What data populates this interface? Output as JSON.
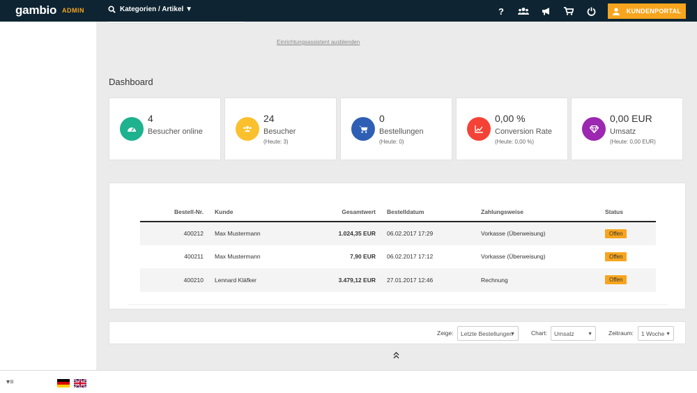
{
  "topbar": {
    "logo": "gambio",
    "admin": "ADMIN",
    "search_label": "Kategorien / Artikel ▼",
    "kundenportal": "KUNDENPORTAL",
    "icons": [
      "help-icon",
      "customers-icon",
      "megaphone-icon",
      "cart-icon",
      "power-icon"
    ]
  },
  "assist_link": "Einrichtungsassistent ausblenden",
  "dashboard_title": "Dashboard",
  "stats": [
    {
      "value": "4",
      "label": "Besucher online",
      "sub": "",
      "color": "#1fb28e",
      "icon": "gauge-icon"
    },
    {
      "value": "24",
      "label": "Besucher",
      "sub": "(Heute: 3)",
      "color": "#fbc02d",
      "icon": "users-icon"
    },
    {
      "value": "0",
      "label": "Bestellungen",
      "sub": "(Heute: 0)",
      "color": "#2e5fb4",
      "icon": "cart-icon"
    },
    {
      "value": "0,00 %",
      "label": "Conversion Rate",
      "sub": "(Heute: 0,00 %)",
      "color": "#f44336",
      "icon": "chart-icon"
    },
    {
      "value": "0,00 EUR",
      "label": "Umsatz",
      "sub": "(Heute: 0,00 EUR)",
      "color": "#9c27b0",
      "icon": "diamond-icon"
    }
  ],
  "orders": {
    "headers": [
      "Bestell-Nr.",
      "Kunde",
      "Gesamtwert",
      "Bestelldatum",
      "Zahlungsweise",
      "Status"
    ],
    "rows": [
      {
        "nr": "400212",
        "kunde": "Max Mustermann",
        "wert": "1.024,35 EUR",
        "datum": "06.02.2017 17:29",
        "zahlung": "Vorkasse (Überweisung)",
        "status": "Offen"
      },
      {
        "nr": "400211",
        "kunde": "Max Mustermann",
        "wert": "7,90 EUR",
        "datum": "06.02.2017 17:12",
        "zahlung": "Vorkasse (Überweisung)",
        "status": "Offen"
      },
      {
        "nr": "400210",
        "kunde": "Lennard Kläfker",
        "wert": "3.479,12 EUR",
        "datum": "27.01.2017 12:46",
        "zahlung": "Rechnung",
        "status": "Offen"
      }
    ]
  },
  "filters": {
    "zeige_label": "Zeige:",
    "zeige_value": "Letzte Bestellungen",
    "chart_label": "Chart:",
    "chart_value": "Umsatz",
    "zeitraum_label": "Zeitraum:",
    "zeitraum_value": "1 Woche"
  },
  "bottombar": {
    "menu_toggle": "▾≡"
  }
}
